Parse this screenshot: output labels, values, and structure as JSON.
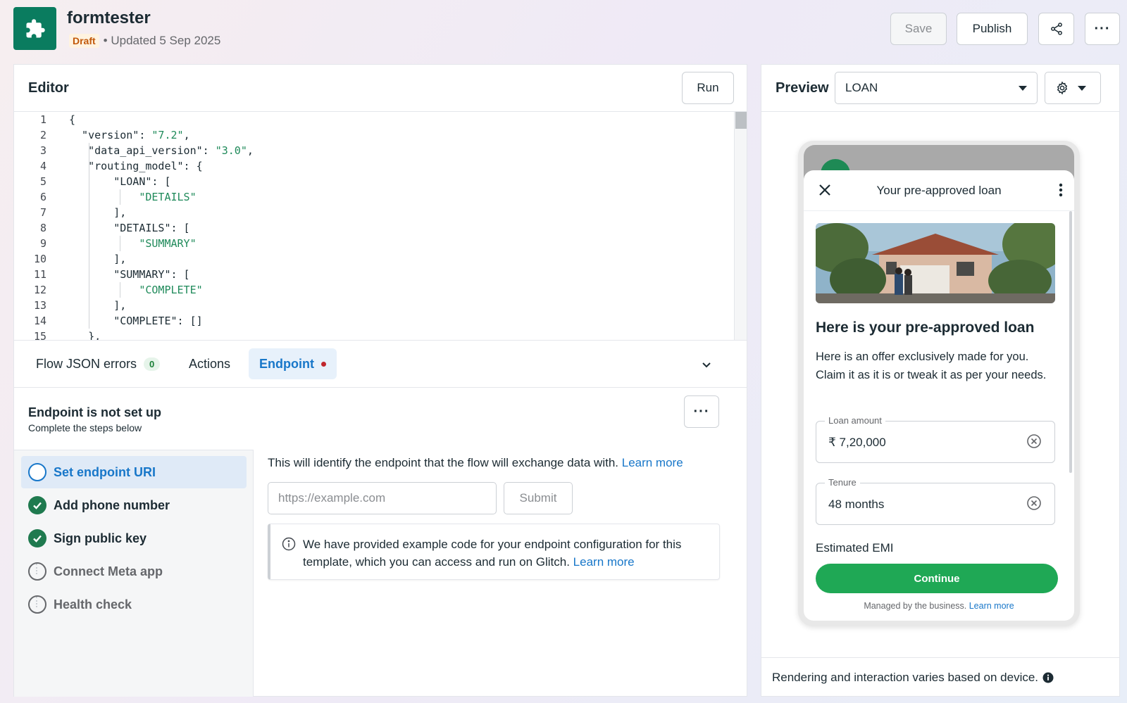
{
  "header": {
    "app_title": "formtester",
    "status_badge": "Draft",
    "updated_text": "• Updated 5 Sep 2025",
    "save_label": "Save",
    "publish_label": "Publish",
    "icons": {
      "app": "puzzle-icon",
      "share": "share-icon",
      "more": "more-icon"
    }
  },
  "editor": {
    "title": "Editor",
    "run_label": "Run",
    "code_lines": [
      {
        "n": "1",
        "text": "{"
      },
      {
        "n": "2",
        "text": "  \"version\": \"7.2\","
      },
      {
        "n": "3",
        "text": "   \"data_api_version\": \"3.0\","
      },
      {
        "n": "4",
        "text": "   \"routing_model\": {"
      },
      {
        "n": "5",
        "text": "       \"LOAN\": ["
      },
      {
        "n": "6",
        "text": "           \"DETAILS\""
      },
      {
        "n": "7",
        "text": "       ],"
      },
      {
        "n": "8",
        "text": "       \"DETAILS\": ["
      },
      {
        "n": "9",
        "text": "           \"SUMMARY\""
      },
      {
        "n": "10",
        "text": "       ],"
      },
      {
        "n": "11",
        "text": "       \"SUMMARY\": ["
      },
      {
        "n": "12",
        "text": "           \"COMPLETE\""
      },
      {
        "n": "13",
        "text": "       ],"
      },
      {
        "n": "14",
        "text": "       \"COMPLETE\": []"
      },
      {
        "n": "15",
        "text": "   },"
      }
    ]
  },
  "tabs": {
    "errors_label": "Flow JSON errors",
    "errors_count": "0",
    "actions_label": "Actions",
    "endpoint_label": "Endpoint"
  },
  "endpoint": {
    "title": "Endpoint is not set up",
    "subtitle": "Complete the steps below",
    "steps": [
      {
        "label": "Set endpoint URI",
        "state": "active"
      },
      {
        "label": "Add phone number",
        "state": "done"
      },
      {
        "label": "Sign public key",
        "state": "done"
      },
      {
        "label": "Connect Meta app",
        "state": "pending"
      },
      {
        "label": "Health check",
        "state": "pending"
      }
    ],
    "description": "This will identify the endpoint that the flow will exchange data with.",
    "learn_more": "Learn more",
    "url_placeholder": "https://example.com",
    "url_value": "",
    "submit_label": "Submit",
    "info_text": "We have provided example code for your endpoint configuration for this template, which you can access and run on Glitch.",
    "info_learn_more": "Learn more"
  },
  "preview": {
    "title": "Preview",
    "screen_selected": "LOAN",
    "footer_text": "Rendering and interaction varies based on device.",
    "sheet": {
      "title": "Your pre-approved loan",
      "heading": "Here is your pre-approved loan",
      "body": "Here is an offer exclusively made for you. Claim it as it is or tweak it as per your needs.",
      "loan_amount_label": "Loan amount",
      "loan_amount_value": "₹ 7,20,000",
      "tenure_label": "Tenure",
      "tenure_value": "48 months",
      "emi_label": "Estimated EMI",
      "continue_label": "Continue",
      "managed_text": "Managed by the business.",
      "managed_link": "Learn more"
    }
  },
  "colors": {
    "accent": "#1877c9",
    "brand_green": "#0a7c5f",
    "continue_green": "#1fa855",
    "error_dot": "#c0262d",
    "draft_text": "#c2590a"
  }
}
